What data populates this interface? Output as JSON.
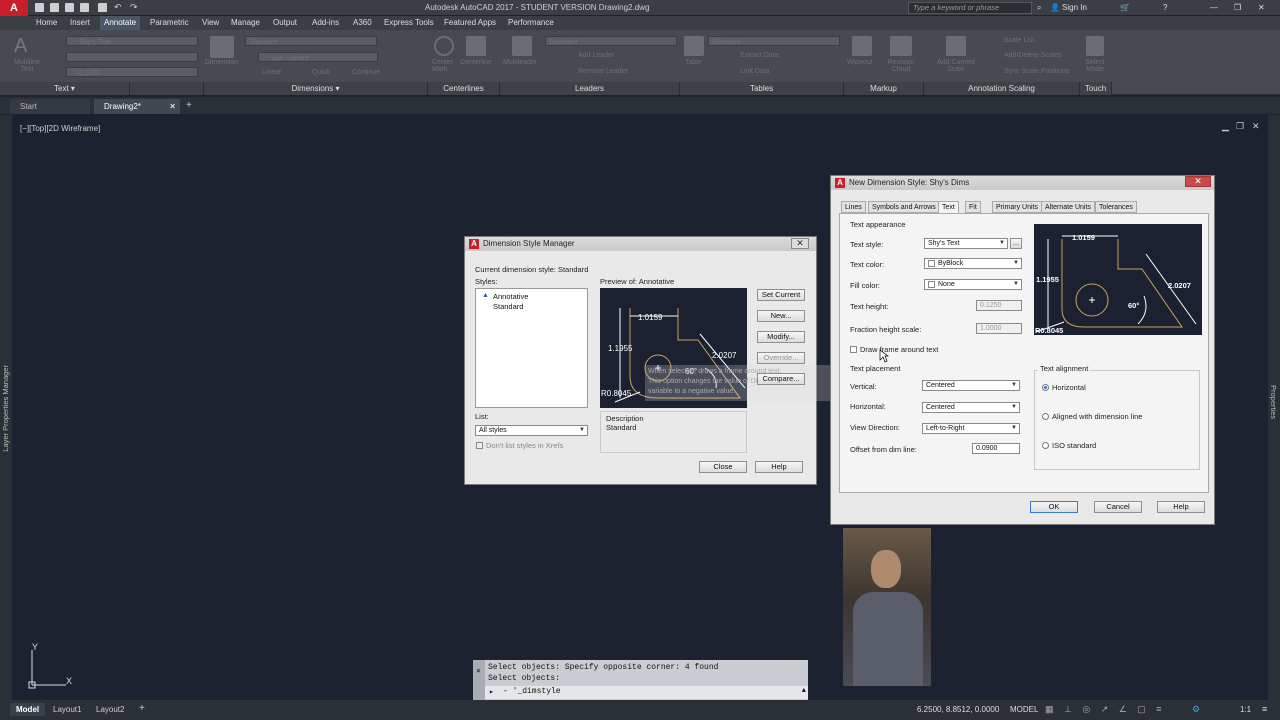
{
  "app": {
    "title": "Autodesk AutoCAD 2017 - STUDENT VERSION    Drawing2.dwg",
    "search_placeholder": "Type a keyword or phrase",
    "sign_in": "Sign In",
    "brand_color": "#c8202a"
  },
  "menu": [
    "Home",
    "Insert",
    "Annotate",
    "Parametric",
    "View",
    "Manage",
    "Output",
    "Add-ins",
    "A360",
    "Express Tools",
    "Featured Apps",
    "Performance"
  ],
  "menu_active": "Annotate",
  "ribbon": {
    "text_panel": {
      "label": "Text",
      "big_button": "Multiline Text",
      "style": "Shy's Text",
      "height": "0.1250"
    },
    "dims_panel": {
      "label": "Dimensions",
      "big_button": "Dimension",
      "style": "Standard",
      "layer": "Use Current",
      "small": [
        "Linear",
        "Quick",
        "Continue"
      ]
    },
    "centerlines_panel": {
      "label": "Centerlines",
      "buttons": [
        "Center Mark",
        "Centerline"
      ]
    },
    "leaders_panel": {
      "label": "Leaders",
      "big_button": "Multileader",
      "style": "Standard",
      "small": [
        "Add Leader",
        "Remove Leader"
      ]
    },
    "tables_panel": {
      "label": "Tables",
      "big_button": "Table",
      "style": "Standard",
      "small": [
        "Extract Data",
        "Link Data"
      ]
    },
    "markup_panel": {
      "label": "Markup",
      "buttons": [
        "Wipeout",
        "Revision Cloud"
      ]
    },
    "scaling_panel": {
      "label": "Annotation Scaling",
      "big_button": "Add Current Scale",
      "small": [
        "Scale List",
        "Add/Delete Scales",
        "Sync Scale Positions"
      ]
    },
    "touch_panel": {
      "label": "Touch",
      "big_button": "Select Mode"
    }
  },
  "file_tabs": [
    "Start",
    "Drawing2*"
  ],
  "viewport_label": "[−][Top][2D Wireframe]",
  "side_left": "Layer Properties Manager",
  "side_right": "Properties",
  "dsm": {
    "title": "Dimension Style Manager",
    "current": "Current dimension style: Standard",
    "styles_label": "Styles:",
    "styles": [
      "Annotative",
      "Standard"
    ],
    "preview_label": "Preview of: Annotative",
    "buttons": [
      "Set Current",
      "New...",
      "Modify...",
      "Override...",
      "Compare..."
    ],
    "list_label": "List:",
    "list_value": "All styles",
    "xref_check": "Don't list styles in Xrefs",
    "description_label": "Description",
    "description_value": "Standard",
    "close": "Close",
    "help": "Help",
    "preview_values": {
      "top": "1.0159",
      "left": "1.1955",
      "right": "2.0207",
      "angle": "60°",
      "radius": "R0.8045"
    },
    "tooltip": [
      "When selected, draws a frame around text.",
      "This option changes the value of DIMGAP",
      "variable to a negative value."
    ]
  },
  "nds": {
    "title": "New Dimension Style: Shy's Dims",
    "tabs": [
      "Lines",
      "Symbols and Arrows",
      "Text",
      "Fit",
      "Primary Units",
      "Alternate Units",
      "Tolerances"
    ],
    "active_tab": "Text",
    "appearance_label": "Text appearance",
    "text_style_label": "Text style:",
    "text_style": "Shy's Text",
    "text_color_label": "Text color:",
    "text_color": "ByBlock",
    "fill_color_label": "Fill color:",
    "fill_color": "None",
    "text_height_label": "Text height:",
    "text_height": "0.1250",
    "fraction_label": "Fraction height scale:",
    "fraction": "1.0000",
    "frame_check": "Draw frame around text",
    "placement_label": "Text placement",
    "vertical_label": "Vertical:",
    "vertical": "Centered",
    "horizontal_label": "Horizontal:",
    "horizontal": "Centered",
    "view_dir_label": "View Direction:",
    "view_dir": "Left-to-Right",
    "offset_label": "Offset from dim line:",
    "offset": "0.0900",
    "alignment_label": "Text alignment",
    "align_options": [
      "Horizontal",
      "Aligned with dimension line",
      "ISO standard"
    ],
    "align_selected": 0,
    "ok": "OK",
    "cancel": "Cancel",
    "help": "Help",
    "preview_values": {
      "top": "1.0159",
      "left": "1.1955",
      "right": "2.0207",
      "angle": "60°",
      "radius": "R0.8045"
    }
  },
  "command": {
    "history": [
      "Select objects: Specify opposite corner: 4 found",
      "Select objects:"
    ],
    "input": "- '_dimstyle"
  },
  "layout_tabs": [
    "Model",
    "Layout1",
    "Layout2"
  ],
  "coords": "6.2500, 8.8512, 0.0000",
  "model_label": "MODEL",
  "scale": "1:1",
  "ucs": {
    "x": "X",
    "y": "Y"
  }
}
